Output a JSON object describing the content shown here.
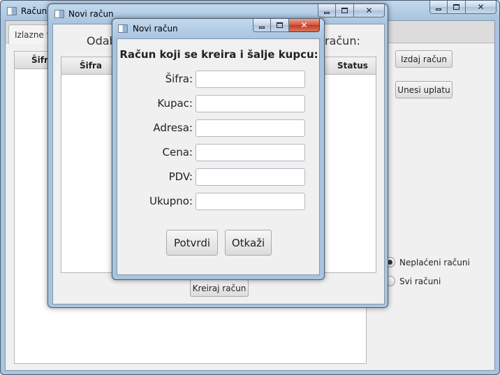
{
  "main_window": {
    "title": "Računo",
    "tab_label": "Izlazne fa",
    "table_headers": [
      "Šifra"
    ],
    "buttons": {
      "issue": "Izdaj račun",
      "enter_payment": "Unesi uplatu"
    },
    "filter_options": [
      {
        "label": "Neplaćeni računi",
        "selected": true
      },
      {
        "label": "Svi računi",
        "selected": false
      }
    ]
  },
  "middle_window": {
    "title": "Novi račun",
    "prompt_left": "Odab",
    "prompt_right": "račun:",
    "table_headers": [
      "Šifra",
      "Status"
    ],
    "create_button": "Kreiraj račun"
  },
  "dialog": {
    "title": "Novi račun",
    "heading": "Račun koji se kreira i šalje kupcu:",
    "fields": [
      {
        "label": "Šifra:",
        "value": ""
      },
      {
        "label": "Kupac:",
        "value": ""
      },
      {
        "label": "Adresa:",
        "value": ""
      },
      {
        "label": "Cena:",
        "value": ""
      },
      {
        "label": "PDV:",
        "value": ""
      },
      {
        "label": "Ukupno:",
        "value": ""
      }
    ],
    "confirm_button": "Potvrdi",
    "cancel_button": "Otkaži"
  },
  "icons": {
    "app": "app-window-icon",
    "minimize": "minimize-icon",
    "maximize": "maximize-icon",
    "close": "close-icon"
  },
  "colors": {
    "close_button_active": "#c23b1f",
    "window_frame": "#a9c4df",
    "client_background": "#f0f0f0"
  }
}
